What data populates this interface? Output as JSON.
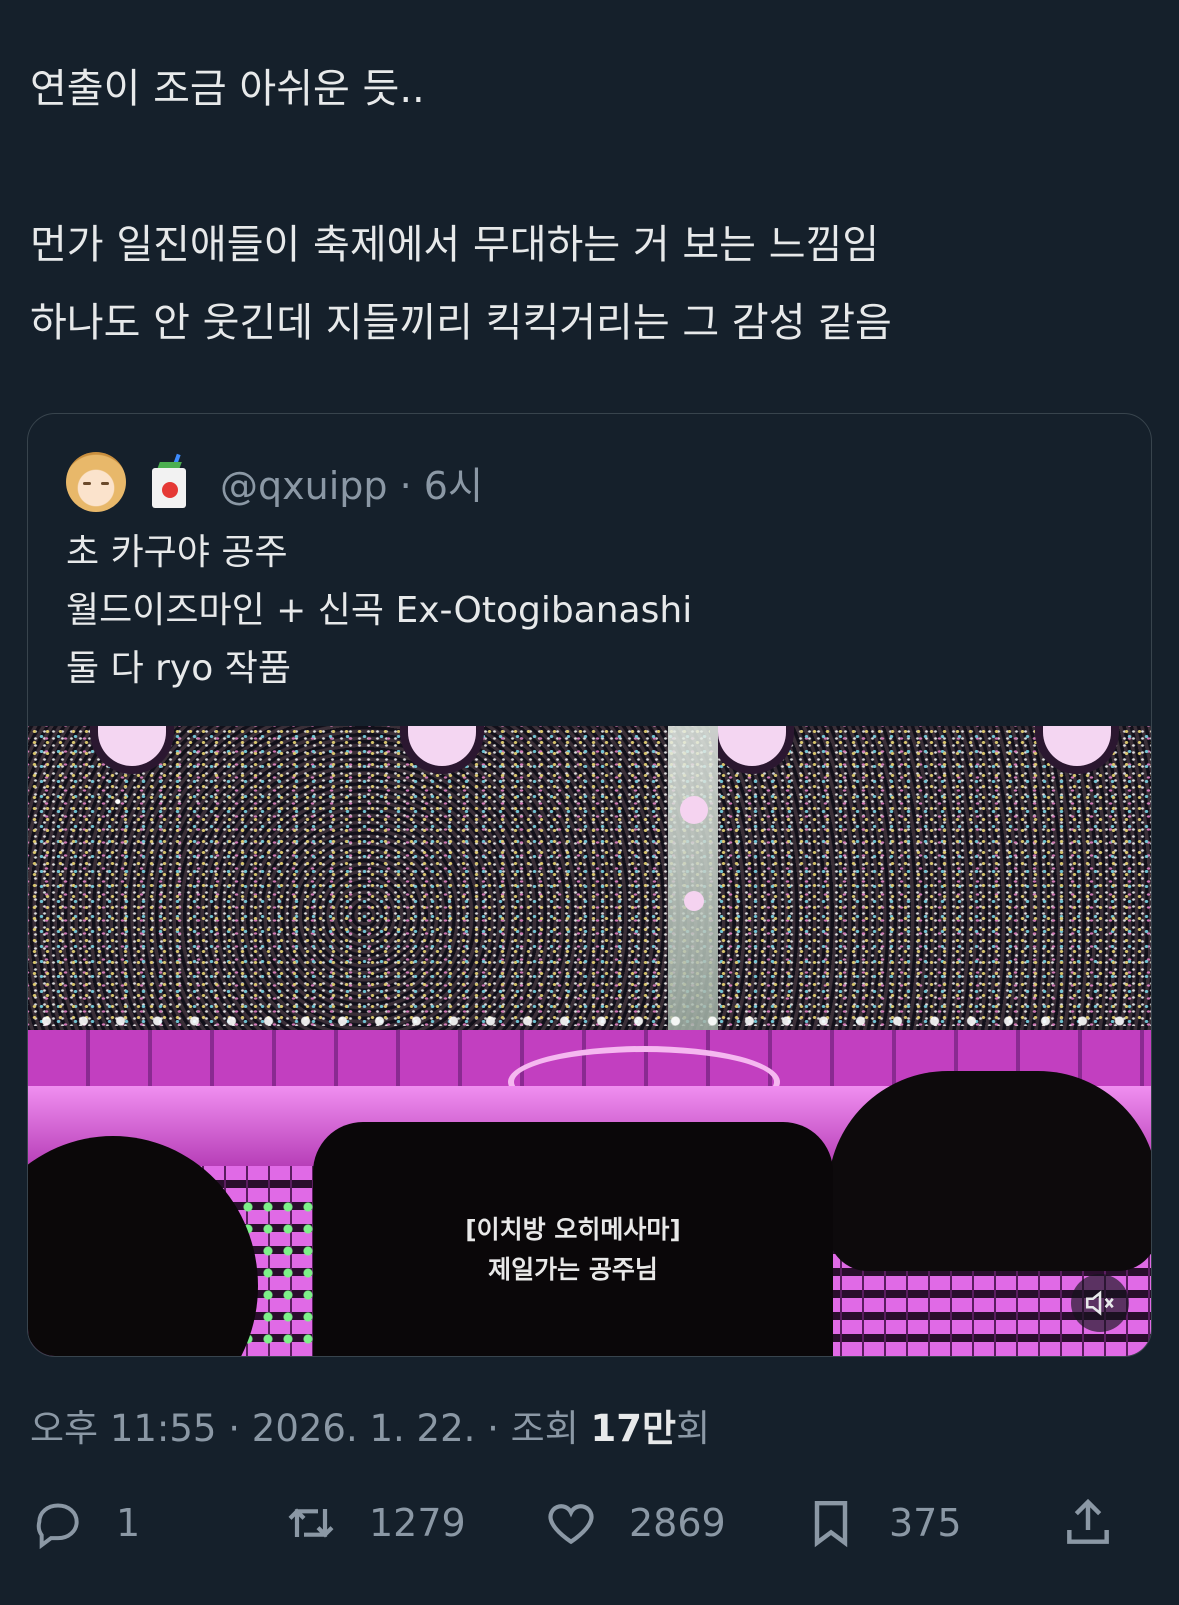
{
  "tweet": {
    "lines": [
      "연출이 조금 아쉬운 듯..",
      "먼가 일진애들이 축제에서 무대하는 거 보는 느낌임",
      "하나도 안 웃긴데 지들끼리 킥킥거리는 그 감성 같음"
    ]
  },
  "quote": {
    "handle": "@qxuipp",
    "separator": "·",
    "time": "6시",
    "lines": [
      "초 카구야 공주",
      "월드이즈마인 + 신곡 Ex-Otogibanashi",
      "둘 다 ryo 작품"
    ],
    "media": {
      "subtitle_line1": "[이치방 오히메사마]",
      "subtitle_line2": "제일가는 공주님",
      "mute_icon": "speaker-muted-icon"
    }
  },
  "meta": {
    "time": "오후 11:55",
    "sep1": "·",
    "date": "2026. 1. 22.",
    "sep2": "·",
    "views_label": "조회",
    "views_count": "17만",
    "views_suffix": "회"
  },
  "actions": {
    "reply_count": "1",
    "retweet_count": "1279",
    "like_count": "2869",
    "bookmark_count": "375"
  },
  "colors": {
    "background": "#15202b",
    "text": "#e7e9ea",
    "secondary": "#8b98a5",
    "border": "#38444d"
  }
}
